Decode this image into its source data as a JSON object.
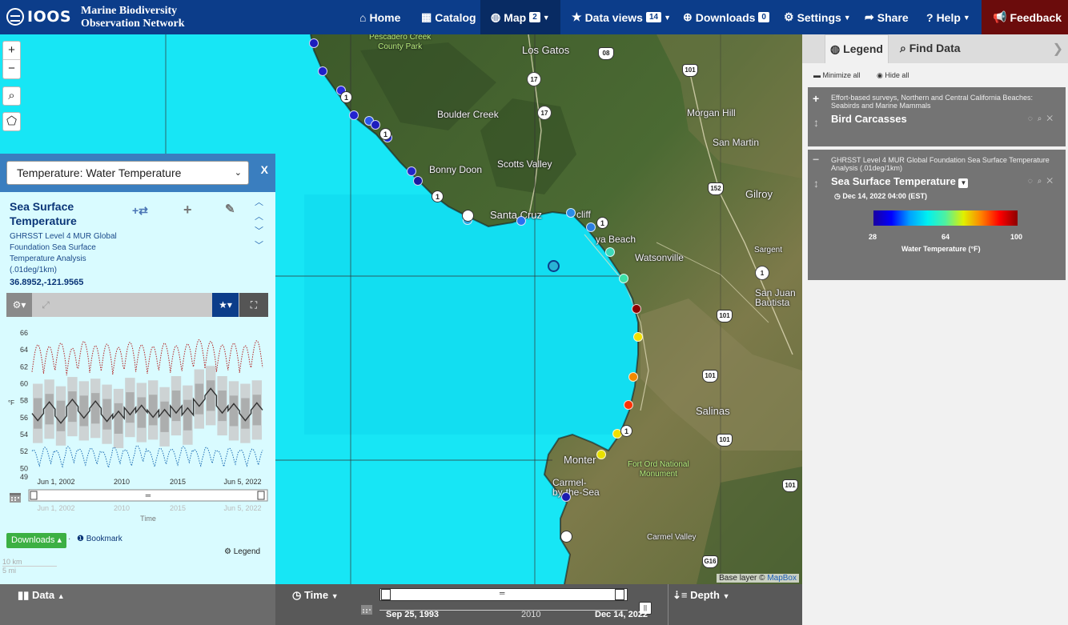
{
  "header": {
    "logo_text": "IOOS",
    "network_line1": "Marine Biodiversity",
    "network_line2": "Observation Network",
    "nav": {
      "home": "Home",
      "catalog": "Catalog",
      "map": "Map",
      "map_badge": "2",
      "dataviews": "Data views",
      "dataviews_badge": "14",
      "downloads": "Downloads",
      "downloads_badge": "0",
      "settings": "Settings",
      "share": "Share",
      "help": "Help",
      "feedback": "Feedback"
    }
  },
  "map": {
    "zoom_in": "+",
    "zoom_out": "−",
    "labels": {
      "pescadero": "Pescadero Creek\nCounty Park",
      "los_gatos": "Los Gatos",
      "boulder_creek": "Boulder Creek",
      "morgan_hill": "Morgan Hill",
      "san_martin": "San Martin",
      "scotts_valley": "Scotts Valley",
      "bonny_doon": "Bonny Doon",
      "santa_cruz": "Santa Cruz",
      "capitola": "cliff",
      "gilroy": "Gilroy",
      "aptos": "ya Beach",
      "watsonville": "Watsonville",
      "sargent": "Sargent",
      "san_juan": "San Juan\nBautista",
      "salinas": "Salinas",
      "monterey": "Monter",
      "fort_ord": "Fort Ord National\nMonument",
      "carmel": "Carmel-\nby-the-Sea",
      "carmel_valley": "Carmel Valley"
    },
    "highways": [
      "08",
      "101",
      "17",
      "17",
      "152",
      "1",
      "101",
      "101",
      "101",
      "101",
      "G16"
    ],
    "attribution_prefix": "Base layer © ",
    "attribution_link": "MapBox"
  },
  "left_panel": {
    "variable_select": "Temperature: Water Temperature",
    "close": "X",
    "title": "Sea Surface Temperature",
    "subtitle": "GHRSST Level 4 MUR Global Foundation Sea Surface Temperature Analysis (.01deg/1km)",
    "coordinates": "36.8952,-121.9565",
    "downloads_button": "Downloads",
    "bookmark": "Bookmark",
    "legend_link": "Legend",
    "scale_km": "10 km",
    "scale_mi": "5 mi"
  },
  "chart_data": {
    "type": "line",
    "title": "",
    "xlabel": "Time",
    "ylabel": "°F",
    "ylim": [
      49,
      66
    ],
    "yticks": [
      49,
      50,
      52,
      54,
      56,
      58,
      60,
      62,
      64,
      66
    ],
    "xticks": [
      "Jun 1, 2002",
      "2010",
      "2015",
      "Jun 5, 2022"
    ],
    "range_ticks": [
      "Jun 1, 2002",
      "2010",
      "2015",
      "Jun 5, 2022"
    ],
    "x_range": [
      "2002-06-01",
      "2022-06-05"
    ],
    "series": [
      {
        "name": "",
        "style": "dotted-max",
        "color": "#b22222",
        "values": [
          64.6,
          64.4,
          64.8,
          64.2,
          65.0,
          64.5,
          64.7,
          64.3,
          64.9,
          64.6,
          64.4,
          64.8,
          64.5,
          64.7,
          65.2,
          65.0,
          64.6,
          64.8,
          64.5,
          65.1
        ]
      },
      {
        "name": "",
        "style": "mean",
        "color": "#333333",
        "values": [
          56.5,
          57.0,
          56.2,
          57.3,
          56.8,
          57.1,
          56.4,
          55.9,
          57.2,
          56.6,
          56.9,
          56.1,
          57.4,
          56.3,
          58.2,
          58.6,
          57.4,
          56.8,
          56.5,
          56.9
        ]
      },
      {
        "name": "",
        "style": "dotted-min",
        "color": "#1f6fb5",
        "values": [
          50.6,
          50.9,
          50.5,
          51.0,
          50.7,
          50.8,
          50.4,
          50.9,
          50.6,
          51.1,
          50.5,
          50.8,
          50.7,
          51.0,
          50.6,
          50.9,
          50.5,
          50.8,
          50.6,
          50.7
        ]
      }
    ]
  },
  "bottom_bar": {
    "data_label": "Data",
    "time_label": "Time",
    "depth_label": "Depth",
    "time_start": "Sep 25, 1993",
    "time_mid": "2010",
    "time_end": "Dec 14, 2022"
  },
  "right_panel": {
    "tab_legend": "Legend",
    "tab_find": "Find Data",
    "minimize_all": "Minimize all",
    "hide_all": "Hide all",
    "layers": [
      {
        "source": "Effort-based surveys, Northern and Central California Beaches: Seabirds and Marine Mammals",
        "name": "Bird Carcasses",
        "toggle": "+"
      },
      {
        "source": "GHRSST Level 4 MUR Global Foundation Sea Surface Temperature Analysis (.01deg/1km)",
        "name": "Sea Surface Temperature",
        "toggle": "−",
        "timestamp": "Dec 14, 2022 04:00 (EST)",
        "colorbar_min": "28",
        "colorbar_mid": "64",
        "colorbar_max": "100",
        "colorbar_label": "Water Temperature (°F)"
      }
    ]
  },
  "colors": {
    "nav_bg": "#0c3d8a",
    "nav_active": "#082b63",
    "feedback_bg": "#6b0c0c",
    "ocean": "#11e2f2",
    "panel_blue": "#3a7ebf",
    "downloads_green": "#3cb043",
    "legend_layer_bg": "#747474"
  },
  "icons": [
    "home-icon",
    "catalog-icon",
    "globe-icon",
    "star-icon",
    "download-icon",
    "gear-icon",
    "share-icon",
    "help-icon",
    "megaphone-icon",
    "zoom-box-icon",
    "layer-filter-icon",
    "shuffle-icon",
    "plus-icon",
    "edit-icon",
    "calendar-icon",
    "bar-chart-icon",
    "clock-icon",
    "depth-icon",
    "search-icon",
    "eye-icon",
    "zoom-layer-icon",
    "close-layer-icon",
    "move-icon"
  ]
}
